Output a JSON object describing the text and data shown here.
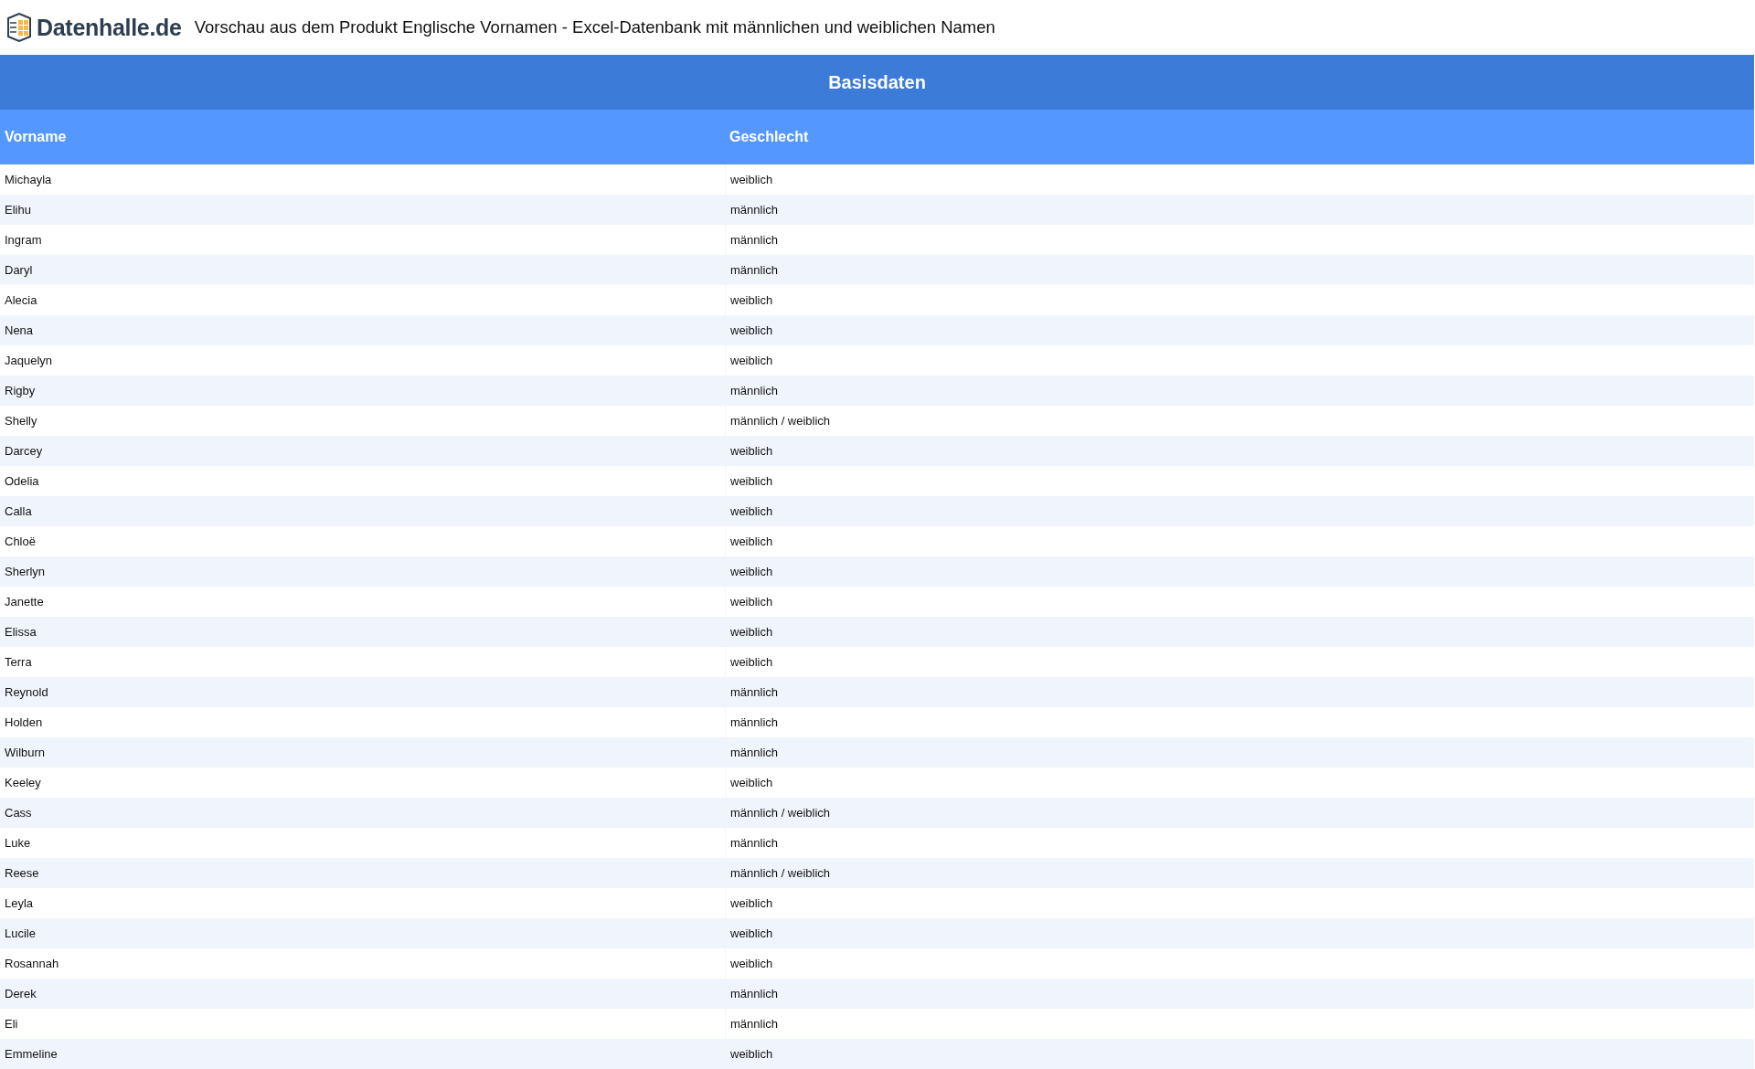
{
  "header": {
    "brand": "Datenhalle.de",
    "title": "Vorschau aus dem Produkt Englische Vornamen - Excel-Datenbank mit männlichen und weiblichen Namen"
  },
  "table": {
    "caption": "Basisdaten",
    "columns": [
      "Vorname",
      "Geschlecht"
    ],
    "rows": [
      [
        "Michayla",
        "weiblich"
      ],
      [
        "Elihu",
        "männlich"
      ],
      [
        "Ingram",
        "männlich"
      ],
      [
        "Daryl",
        "männlich"
      ],
      [
        "Alecia",
        "weiblich"
      ],
      [
        "Nena",
        "weiblich"
      ],
      [
        "Jaquelyn",
        "weiblich"
      ],
      [
        "Rigby",
        "männlich"
      ],
      [
        "Shelly",
        "männlich / weiblich"
      ],
      [
        "Darcey",
        "weiblich"
      ],
      [
        "Odelia",
        "weiblich"
      ],
      [
        "Calla",
        "weiblich"
      ],
      [
        "Chloë",
        "weiblich"
      ],
      [
        "Sherlyn",
        "weiblich"
      ],
      [
        "Janette",
        "weiblich"
      ],
      [
        "Elissa",
        "weiblich"
      ],
      [
        "Terra",
        "weiblich"
      ],
      [
        "Reynold",
        "männlich"
      ],
      [
        "Holden",
        "männlich"
      ],
      [
        "Wilburn",
        "männlich"
      ],
      [
        "Keeley",
        "weiblich"
      ],
      [
        "Cass",
        "männlich / weiblich"
      ],
      [
        "Luke",
        "männlich"
      ],
      [
        "Reese",
        "männlich / weiblich"
      ],
      [
        "Leyla",
        "weiblich"
      ],
      [
        "Lucile",
        "weiblich"
      ],
      [
        "Rosannah",
        "weiblich"
      ],
      [
        "Derek",
        "männlich"
      ],
      [
        "Eli",
        "männlich"
      ],
      [
        "Emmeline",
        "weiblich"
      ]
    ]
  }
}
